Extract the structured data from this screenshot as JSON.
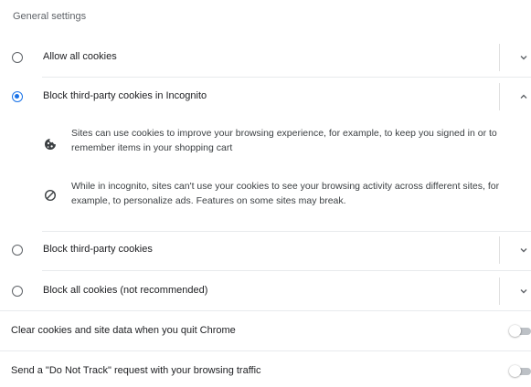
{
  "section_title": "General settings",
  "cookie_options": [
    {
      "label": "Allow all cookies",
      "selected": false,
      "expanded": false
    },
    {
      "label": "Block third-party cookies in Incognito",
      "selected": true,
      "expanded": true
    },
    {
      "label": "Block third-party cookies",
      "selected": false,
      "expanded": false
    },
    {
      "label": "Block all cookies (not recommended)",
      "selected": false,
      "expanded": false
    }
  ],
  "incognito_details": [
    {
      "icon": "cookie-icon",
      "text": "Sites can use cookies to improve your browsing experience, for example, to keep you signed in or to remember items in your shopping cart"
    },
    {
      "icon": "block-icon",
      "text": "While in incognito, sites can't use your cookies to see your browsing activity across different sites, for example, to personalize ads. Features on some sites may break."
    }
  ],
  "toggles": [
    {
      "label": "Clear cookies and site data when you quit Chrome",
      "enabled": false
    },
    {
      "label": "Send a \"Do Not Track\" request with your browsing traffic",
      "enabled": false
    }
  ],
  "colors": {
    "accent": "#1a73e8",
    "text": "#202124",
    "secondary_text": "#5f6368",
    "divider": "#e8eaed"
  }
}
